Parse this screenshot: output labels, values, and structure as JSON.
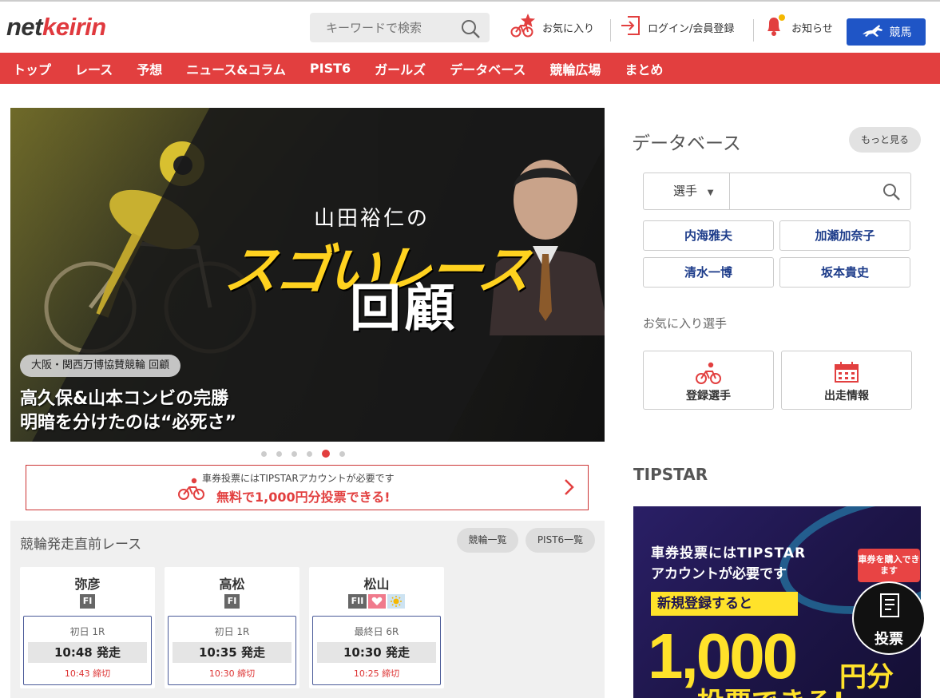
{
  "logo": {
    "part1": "net",
    "part2": "keirin"
  },
  "search": {
    "placeholder": "キーワードで検索"
  },
  "header": {
    "favorites": "お気に入り",
    "login": "ログイン/会員登録",
    "notifications": "お知らせ",
    "keiba": "競馬"
  },
  "nav": [
    "トップ",
    "レース",
    "予想",
    "ニュース&コラム",
    "PIST6",
    "ガールズ",
    "データベース",
    "競輪広場",
    "まとめ"
  ],
  "hero": {
    "title_small": "山田裕仁の",
    "title_big": "スゴいレース",
    "title_kanji": "回顧",
    "badge": "大阪・関西万博協賛競輪 回顧",
    "headline1": "高久保&山本コンビの完勝",
    "headline2": "明暗を分けたのは“必死さ”",
    "active_slide": 4
  },
  "tipstar_banner": {
    "line1": "車券投票にはTIPSTARアカウントが必要です",
    "line2": "無料で1,000円分投票できる!"
  },
  "races": {
    "title": "競輪発走直前レース",
    "btn_list": "競輪一覧",
    "btn_pist6": "PIST6一覧",
    "cards": [
      {
        "venue": "弥彦",
        "grade": "FI",
        "round": "初日 1R",
        "time": "10:48 発走",
        "deadline": "10:43 締切"
      },
      {
        "venue": "高松",
        "grade": "FI",
        "round": "初日 1R",
        "time": "10:35 発走",
        "deadline": "10:30 締切"
      },
      {
        "venue": "松山",
        "grade": "FII",
        "round": "最終日 6R",
        "time": "10:30 発走",
        "deadline": "10:25 締切"
      }
    ]
  },
  "database": {
    "title": "データベース",
    "more": "もっと見る",
    "select": "選手",
    "players": [
      "内海雅夫",
      "加瀬加奈子",
      "清水一博",
      "坂本貴史"
    ],
    "fav_title": "お気に入り選手",
    "fav_registered": "登録選手",
    "fav_entries": "出走情報"
  },
  "tipstar": {
    "title": "TIPSTAR",
    "ad_line1": "車券投票にはTIPSTAR",
    "ad_line2": "アカウントが必要です",
    "ad_line3": "新規登録すると",
    "ad_big": "1,000",
    "ad_unit": "円分",
    "ad_line4": "投票できる!"
  },
  "floating": {
    "bubble": "車券を購入できます",
    "label": "投票"
  },
  "colors": {
    "brand_red": "#e23f3f",
    "keiba_blue": "#1f55c6",
    "player_blue": "#1d3c8a"
  }
}
